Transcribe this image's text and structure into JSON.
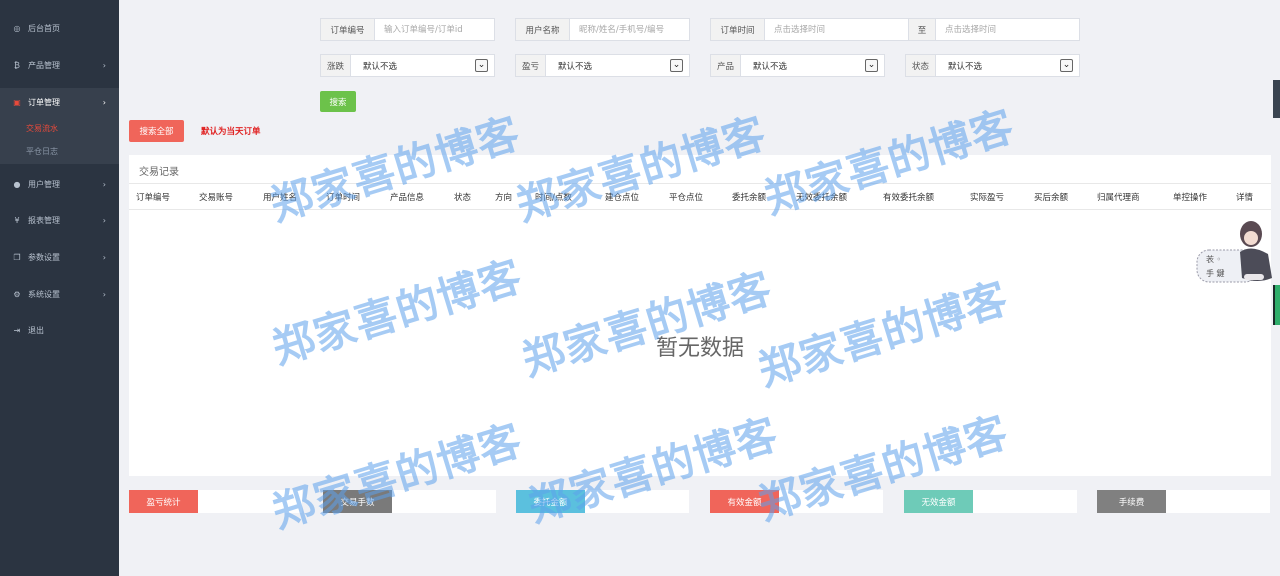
{
  "sidebar": {
    "items": [
      {
        "label": "后台首页",
        "icon": "dashboard-icon",
        "glyph": "◎",
        "chevron": false
      },
      {
        "label": "产品管理",
        "icon": "bitcoin-icon",
        "glyph": "₿",
        "chevron": true
      },
      {
        "label": "订单管理",
        "icon": "order-icon",
        "glyph": "▣",
        "chevron": true,
        "active": true
      },
      {
        "label": "用户管理",
        "icon": "user-icon",
        "glyph": "●",
        "chevron": true
      },
      {
        "label": "报表管理",
        "icon": "yen-icon",
        "glyph": "¥",
        "chevron": true
      },
      {
        "label": "参数设置",
        "icon": "copy-icon",
        "glyph": "❐",
        "chevron": true
      },
      {
        "label": "系统设置",
        "icon": "gears-icon",
        "glyph": "⚙",
        "chevron": true
      },
      {
        "label": "退出",
        "icon": "logout-icon",
        "glyph": "⇥",
        "chevron": false
      }
    ],
    "submenu": [
      {
        "label": "交易流水",
        "active": true
      },
      {
        "label": "平仓日志",
        "active": false
      }
    ]
  },
  "filters": {
    "order_no": {
      "label": "订单编号",
      "placeholder": "输入订单编号/订单id"
    },
    "user_name": {
      "label": "用户名称",
      "placeholder": "昵称/姓名/手机号/编号"
    },
    "order_time": {
      "label": "订单时间",
      "placeholder": "点击选择时间"
    },
    "to": {
      "label": "至",
      "placeholder": "点击选择时间"
    },
    "rise_fall": {
      "label": "涨跌",
      "value": "默认不选"
    },
    "profit_loss": {
      "label": "盈亏",
      "value": "默认不选"
    },
    "product": {
      "label": "产品",
      "value": "默认不选"
    },
    "status": {
      "label": "状态",
      "value": "默认不选"
    }
  },
  "buttons": {
    "search": "搜索",
    "search_all": "搜索全部",
    "default_note": "默认为当天订单"
  },
  "table": {
    "title": "交易记录",
    "columns": [
      "订单编号",
      "交易账号",
      "用户姓名",
      "订单时间",
      "产品信息",
      "状态",
      "方向",
      "时间/点数",
      "建仓点位",
      "平仓点位",
      "委托余额",
      "无效委托余额",
      "有效委托余额",
      "实际盈亏",
      "买后余额",
      "归属代理商",
      "单控操作",
      "详情"
    ],
    "empty_text": "暂无数据"
  },
  "stats": [
    {
      "label": "盈亏统计",
      "value": "",
      "color": "#f0655a"
    },
    {
      "label": "交易手数",
      "value": "",
      "color": "#7a7a7a"
    },
    {
      "label": "委托金额",
      "value": "",
      "color": "#5bc0de"
    },
    {
      "label": "有效金额",
      "value": "",
      "color": "#f0655a"
    },
    {
      "label": "无效金额",
      "value": "",
      "color": "#6ecbb8"
    },
    {
      "label": "手续费",
      "value": "",
      "color": "#808080"
    }
  ],
  "watermark": "郑家喜的博客",
  "colors": {
    "sidebar_bg": "#2b3441",
    "active_red": "#e94a3b",
    "search_green": "#6cc24a",
    "search_all_red": "#f0655a"
  }
}
